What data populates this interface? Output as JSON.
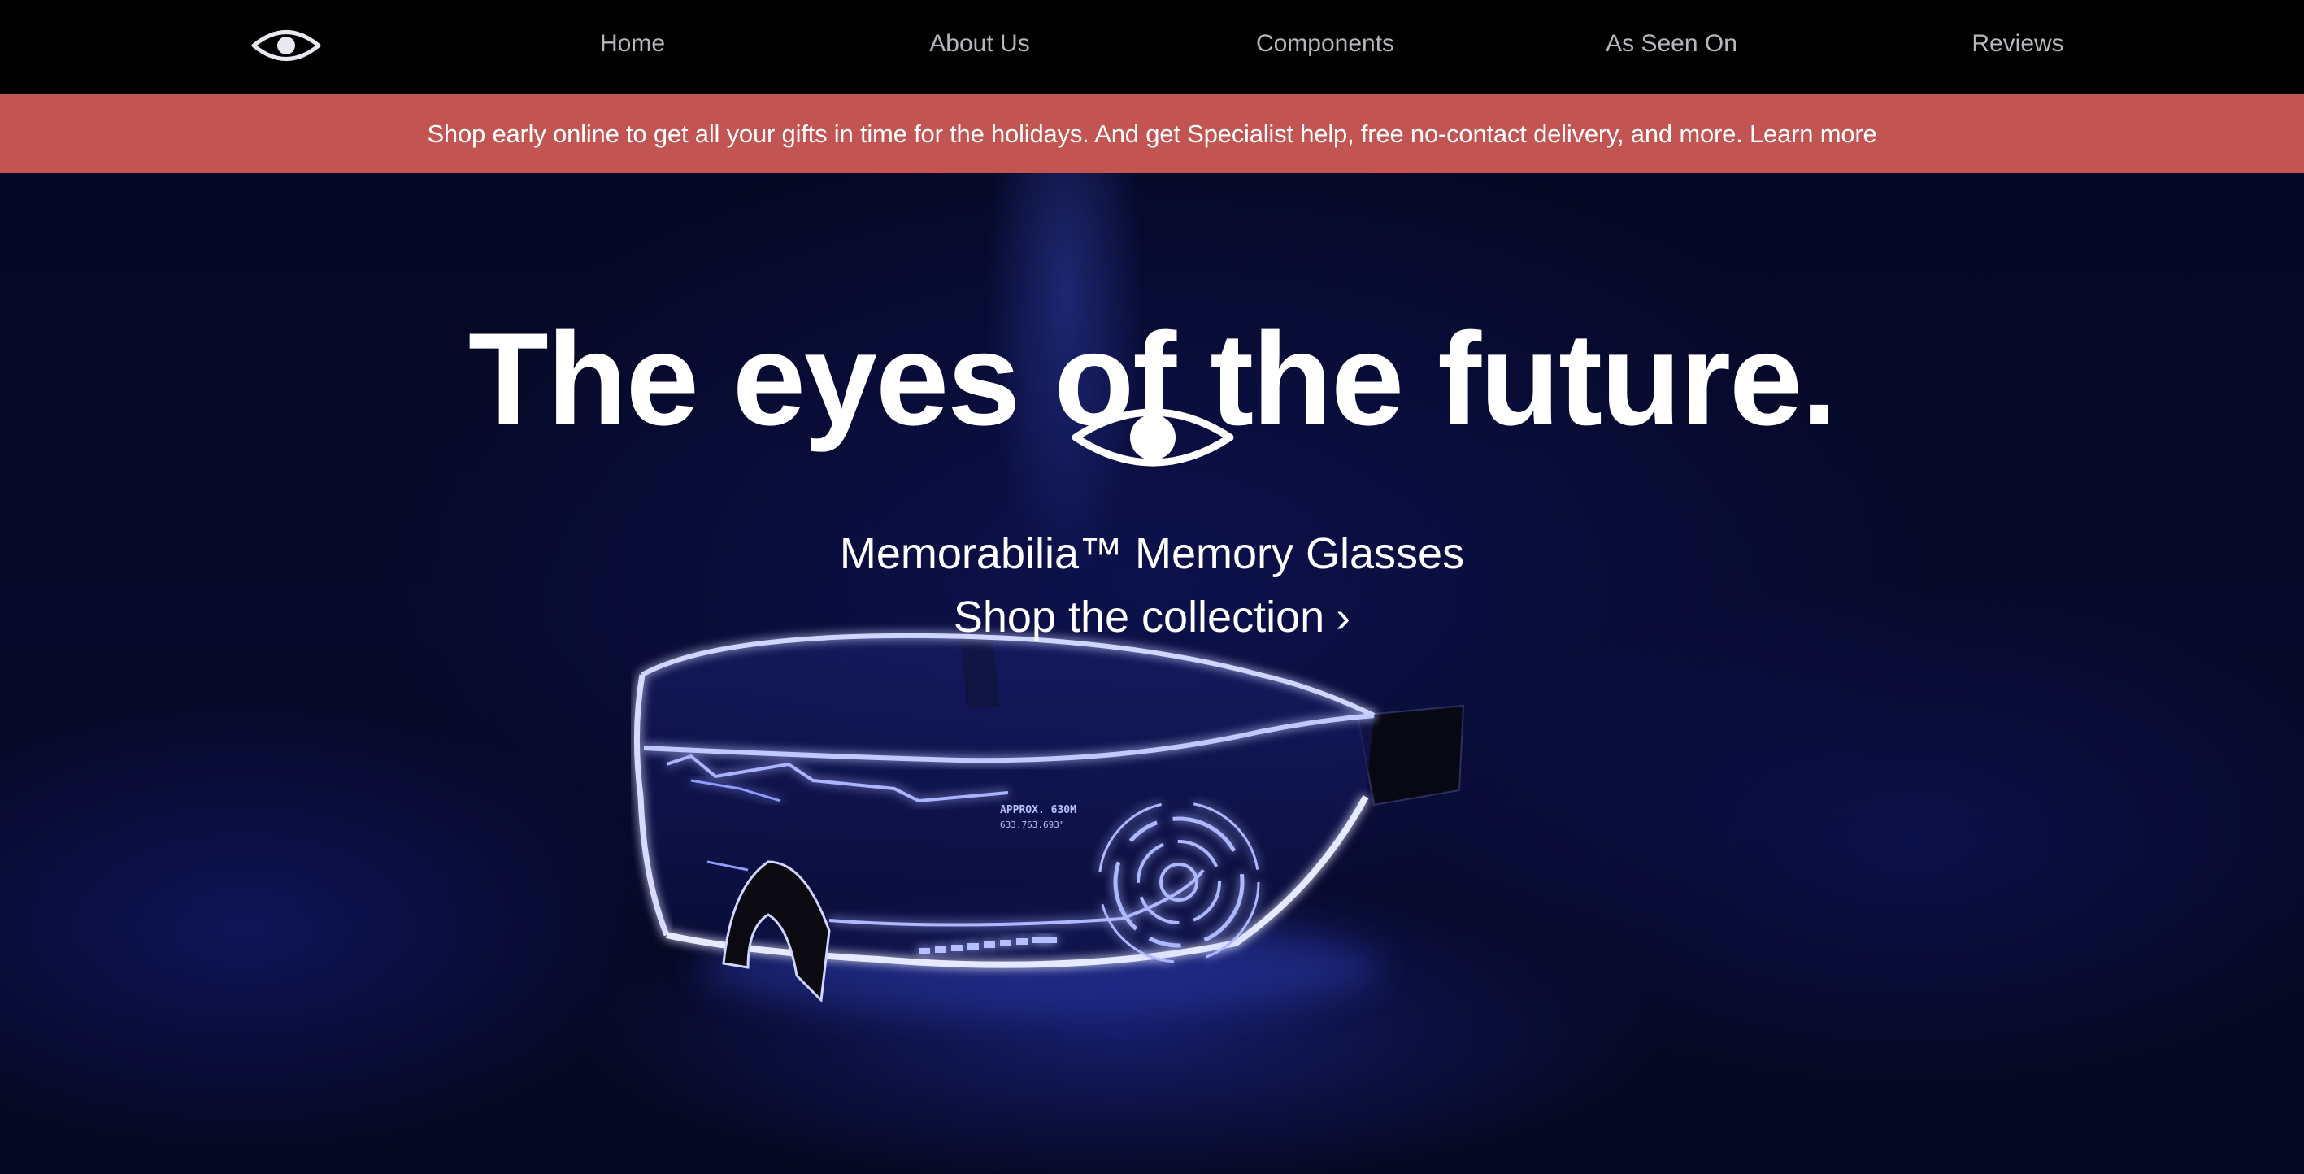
{
  "nav": {
    "logo_icon": "eye-icon",
    "items": [
      {
        "label": "Home"
      },
      {
        "label": "About Us"
      },
      {
        "label": "Components"
      },
      {
        "label": "As Seen On"
      },
      {
        "label": "Reviews"
      }
    ]
  },
  "banner": {
    "text": "Shop early online to get all your gifts in time for the holidays. And get Specialist help, free no-contact delivery, and more.",
    "link_label": "Learn more",
    "color": "#c25452"
  },
  "hero": {
    "title": "The eyes of the future.",
    "icon": "eye-icon",
    "product_name": "Memorabilia™ Memory Glasses",
    "cta_label": "Shop the collection",
    "cta_icon": "chevron-right-icon",
    "cta_glyph": "›",
    "image": "glowing-visor-glasses",
    "glasses_readout": [
      "APPROX. 630M",
      "633.763.693\""
    ]
  },
  "colors": {
    "nav_bg": "#000000",
    "nav_text": "#b6b7bd",
    "hero_bg": "#050824",
    "glow": "#4a5cff",
    "text": "#ffffff"
  }
}
